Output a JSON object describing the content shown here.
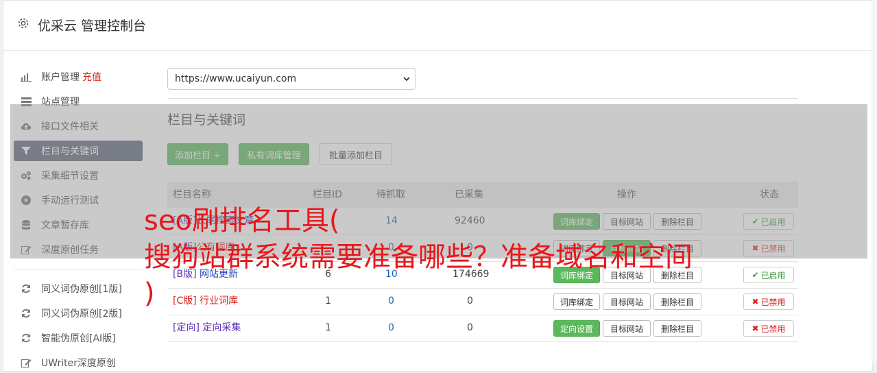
{
  "header": {
    "title": "优采云 管理控制台",
    "icon": "gear-icon"
  },
  "sidebar": {
    "items": [
      {
        "label": "账户管理",
        "extra": "充值",
        "icon": "bar-chart-icon"
      },
      {
        "label": "站点管理",
        "icon": "server-icon"
      },
      {
        "label": "接口文件相关",
        "icon": "cloud-upload-icon"
      },
      {
        "label": "栏目与关键词",
        "icon": "filter-icon",
        "active": true
      },
      {
        "label": "采集细节设置",
        "icon": "cogs-icon"
      },
      {
        "label": "手动运行测试",
        "icon": "play-circle-icon"
      },
      {
        "label": "文章暂存库",
        "icon": "database-icon"
      },
      {
        "label": "深度原创任务",
        "icon": "edit-icon"
      }
    ],
    "items2": [
      {
        "label": "同义词伪原创[1版]",
        "icon": "refresh-icon"
      },
      {
        "label": "同义词伪原创[2版]",
        "icon": "refresh-icon"
      },
      {
        "label": "智能伪原创[AI版]",
        "icon": "refresh-icon"
      },
      {
        "label": "UWriter深度原创",
        "icon": "edit-icon"
      }
    ]
  },
  "site_select": {
    "value": "https://www.ucaiyun.com"
  },
  "section": {
    "title": "栏目与关键词"
  },
  "toolbar": {
    "add_label": "添加栏目 +",
    "private_label": "私有词库管理",
    "batch_label": "批量添加栏目"
  },
  "table": {
    "headers": {
      "name": "栏目名称",
      "id": "栏目ID",
      "pending": "待抓取",
      "collected": "已采集",
      "actions": "操作",
      "status": "状态"
    },
    "rows": [
      {
        "tag": "[A版]",
        "name": "长尾搜索文章",
        "id": "",
        "pending": "14",
        "collected": "92460",
        "btn1": "词库绑定",
        "btn2": "目标网站",
        "btn3": "删除栏目",
        "status": "已启用",
        "on": true
      },
      {
        "tag": "[A版]",
        "name": "公有词库",
        "id": "",
        "pending": "0",
        "collected": "0",
        "btn1": "词库绑定",
        "btn2": "目标网站",
        "btn3": "删除栏目",
        "status": "已禁用",
        "on": false
      },
      {
        "tag": "[B版]",
        "name": "网站更新",
        "id": "6",
        "pending": "10",
        "collected": "174669",
        "btn1": "词库绑定",
        "btn2": "目标网站",
        "btn3": "删除栏目",
        "status": "已启用",
        "on": true
      },
      {
        "tag": "[C版]",
        "name": "行业词库",
        "id": "1",
        "pending": "0",
        "collected": "0",
        "btn1": "词库绑定",
        "btn2": "目标网站",
        "btn3": "删除栏目",
        "status": "已禁用",
        "on": false
      },
      {
        "tag": "[定向]",
        "name": "定向采集",
        "id": "1",
        "pending": "0",
        "collected": "0",
        "btn1": "定向设置",
        "btn2": "目标网站",
        "btn3": "删除栏目",
        "status": "已禁用",
        "on": false
      }
    ]
  },
  "overlay_text": "seo刷排名工具(\n搜狗站群系统需要准备哪些？准备域名和空间\n)",
  "colors": {
    "green": "#5cb85c",
    "active_sidebar": "#5a6578",
    "red": "#d9231c"
  }
}
